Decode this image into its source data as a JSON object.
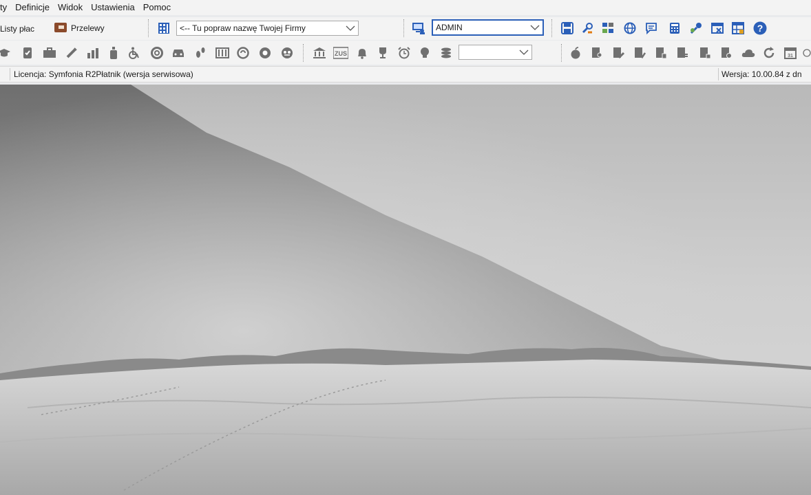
{
  "menu": {
    "items": [
      "ty",
      "Definicje",
      "Widok",
      "Ustawienia",
      "Pomoc"
    ]
  },
  "toolbar1": {
    "listy_plac": "Listy płac",
    "przelewy": "Przelewy",
    "company_combo": "<-- Tu popraw nazwę Twojej Firmy",
    "user_combo": "ADMIN"
  },
  "toolbar2": {
    "filter_combo": ""
  },
  "statusbar": {
    "license": "Licencja: Symfonia R2Płatnik (wersja serwisowa)",
    "version": "Wersja: 10.00.84 z dn"
  },
  "colors": {
    "accent_blue": "#2b5fb8",
    "brown": "#8b4a2b",
    "orange": "#e07a10",
    "gray_icon": "#707070"
  },
  "icons": {
    "toolbar1_right": [
      "save-icon",
      "tools-icon",
      "network-icon",
      "globe-icon",
      "message-icon",
      "calculator-icon",
      "key-icon",
      "window-close-icon",
      "table-icon",
      "help-icon"
    ],
    "toolbar2_left": [
      "education-icon",
      "medal-icon",
      "briefcase-icon",
      "syringe-icon",
      "chart-icon",
      "bottle-icon",
      "wheelchair-icon",
      "lifebuoy-icon",
      "car-icon",
      "footprints-icon",
      "barcode-icon",
      "disc-icon",
      "shield-icon",
      "badge-icon",
      "bank-icon",
      "zus-icon",
      "bell-icon",
      "trophy-icon",
      "alarm-clock-icon",
      "bulb-icon",
      "coins-icon"
    ],
    "toolbar2_right": [
      "apple-icon",
      "doc-person-icon",
      "doc-edit-icon",
      "doc-check-icon",
      "doc-group-icon",
      "doc-list-icon",
      "doc-stamp-icon",
      "doc-seal-icon",
      "cloud-icon",
      "refresh-icon",
      "calendar-icon",
      "clock-icon"
    ]
  }
}
